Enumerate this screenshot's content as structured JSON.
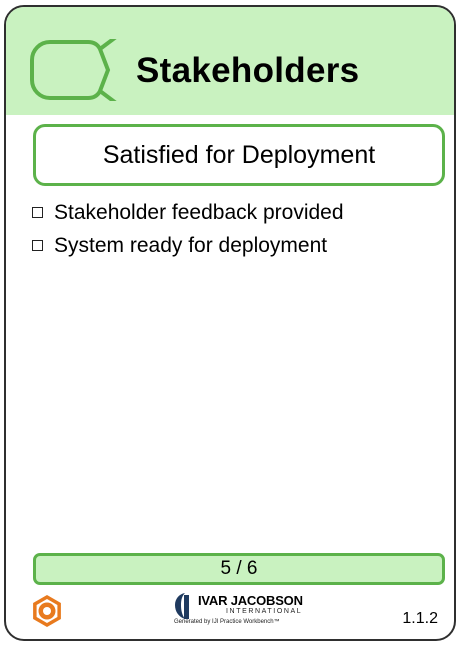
{
  "card": {
    "title": "Stakeholders",
    "state": "Satisfied for Deployment",
    "checklist": [
      "Stakeholder feedback provided",
      "System ready for deployment"
    ],
    "progress_text": "5 / 6",
    "version": "1.1.2"
  },
  "footer": {
    "company": "IVAR JACOBSON",
    "company_sub": "INTERNATIONAL",
    "generated_by": "Generated by IJI Practice Workbench™"
  },
  "icons": {
    "alpha": "alpha-symbol-icon",
    "settings": "gear-icon",
    "logo": "ivar-jacobson-logo"
  },
  "colors": {
    "header_bg": "#c9f2c0",
    "accent_green": "#5cb24a",
    "gear_orange": "#e87a1e",
    "logo_blue": "#1f3a5f"
  }
}
